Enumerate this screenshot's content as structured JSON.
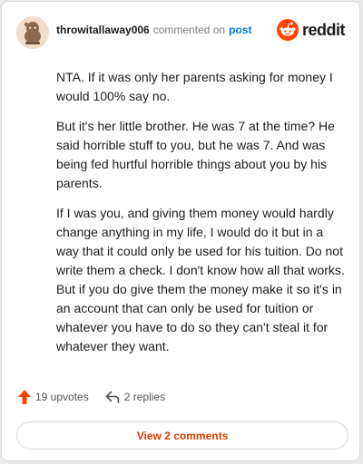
{
  "header": {
    "username": "throwitallaway006",
    "action": "commented on",
    "target": "post",
    "brand": "reddit"
  },
  "comment": {
    "paragraphs": [
      "NTA. If it was only her parents asking for money I would 100% say no.",
      "But it's her little brother. He was 7 at the time? He said horrible stuff to you, but he was 7. And was being fed hurtful horrible things about you by his parents.",
      "If I was you, and giving them money would hardly change anything in my life, I would do it but in a way that it could only be used for his tuition. Do not write them a check. I don't know how all that works. But if you do give them the money make it so it's in an account that can only be used for tuition or whatever you have to do so they can't steal it for whatever they want."
    ]
  },
  "footer": {
    "upvotes": "19 upvotes",
    "replies": "2 replies",
    "view_comments": "View 2 comments"
  },
  "colors": {
    "accent": "#ff4500",
    "link": "#0079d3",
    "view_button_text": "#d93a00"
  },
  "icons": {
    "avatar": "snoo-avatar",
    "brand": "reddit-logo-icon",
    "upvote": "upvote-arrow-icon",
    "reply": "reply-arrow-icon"
  }
}
